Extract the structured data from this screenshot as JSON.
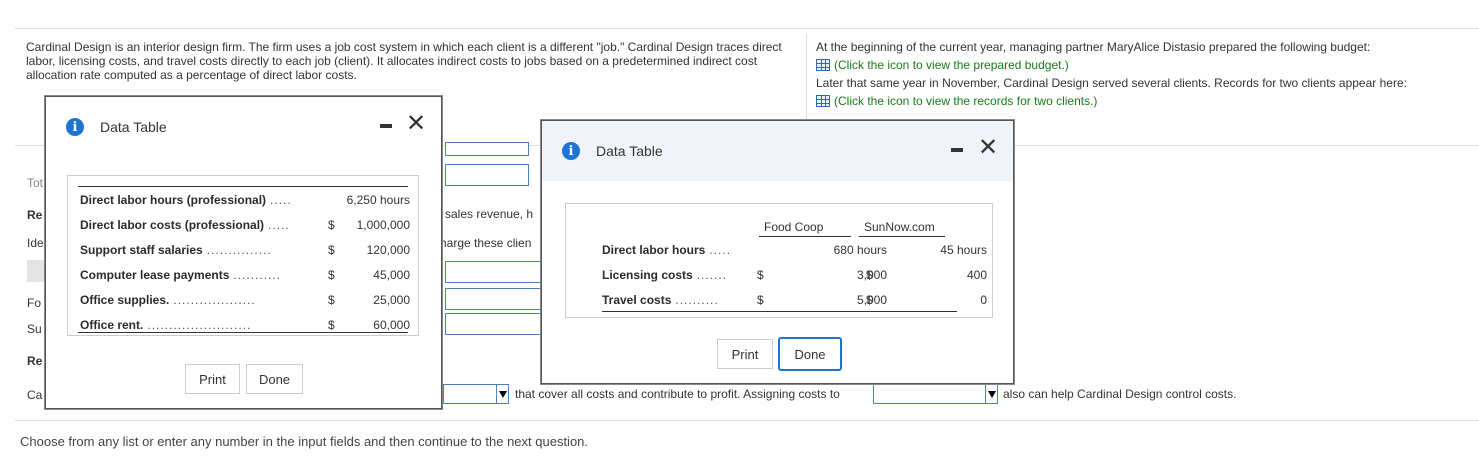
{
  "intro": {
    "left_paragraph": "Cardinal Design is an interior design firm. The firm uses a job cost system in which each client is a different \"job.\" Cardinal Design traces direct labor, licensing costs, and travel costs directly to each job (client). It allocates indirect costs to jobs based on a predetermined indirect cost allocation rate computed as a percentage of direct labor costs.",
    "right_line1": "At the beginning of the current year, managing partner MaryAlice Distasio prepared the following budget:",
    "right_link1": "(Click the icon to view the prepared budget.)",
    "right_line2": "Later that same year in November, Cardinal Design served several clients. Records for two clients appear here:",
    "right_link2": "(Click the icon to view the records for two clients.)"
  },
  "background": {
    "frag_tot": "Tot",
    "frag_re1": "Re",
    "frag_ide": "Ide",
    "frag_fo": "Fo",
    "frag_su": "Su",
    "frag_re2": "Re",
    "frag_ca": "Ca",
    "frag_sales": "sales revenue, h",
    "frag_charge": "harge these clien",
    "bottom_text1": "that cover all costs and contribute to profit. Assigning costs to",
    "bottom_text2": "also can help Cardinal Design control costs.",
    "footer": "Choose from any list or enter any number in the input fields and then continue to the next question."
  },
  "dialog_budget": {
    "title": "Data Table",
    "rows": [
      {
        "label": "Direct labor hours (professional)",
        "dots": ".....",
        "sym": "",
        "value": "6,250 hours"
      },
      {
        "label": "Direct labor costs (professional)",
        "dots": ".....",
        "sym": "$",
        "value": "1,000,000"
      },
      {
        "label": "Support staff salaries",
        "dots": "...............",
        "sym": "$",
        "value": "120,000"
      },
      {
        "label": "Computer lease payments",
        "dots": "...........",
        "sym": "$",
        "value": "45,000"
      },
      {
        "label": "Office supplies.",
        "dots": "...................",
        "sym": "$",
        "value": "25,000"
      },
      {
        "label": "Office rent.",
        "dots": "........................",
        "sym": "$",
        "value": "60,000"
      }
    ],
    "print_label": "Print",
    "done_label": "Done"
  },
  "dialog_records": {
    "title": "Data Table",
    "col1": "Food Coop",
    "col2": "SunNow.com",
    "rows": [
      {
        "label": "Direct labor hours",
        "dots": ".....",
        "sym1": "",
        "v1": "680 hours",
        "sym2": "",
        "v2": "45 hours"
      },
      {
        "label": "Licensing costs",
        "dots": ".......",
        "sym1": "$",
        "v1": "3,000",
        "sym2": "$",
        "v2": "400"
      },
      {
        "label": "Travel costs",
        "dots": "..........",
        "sym1": "$",
        "v1": "5,000",
        "sym2": "$",
        "v2": "0"
      }
    ],
    "print_label": "Print",
    "done_label": "Done"
  }
}
